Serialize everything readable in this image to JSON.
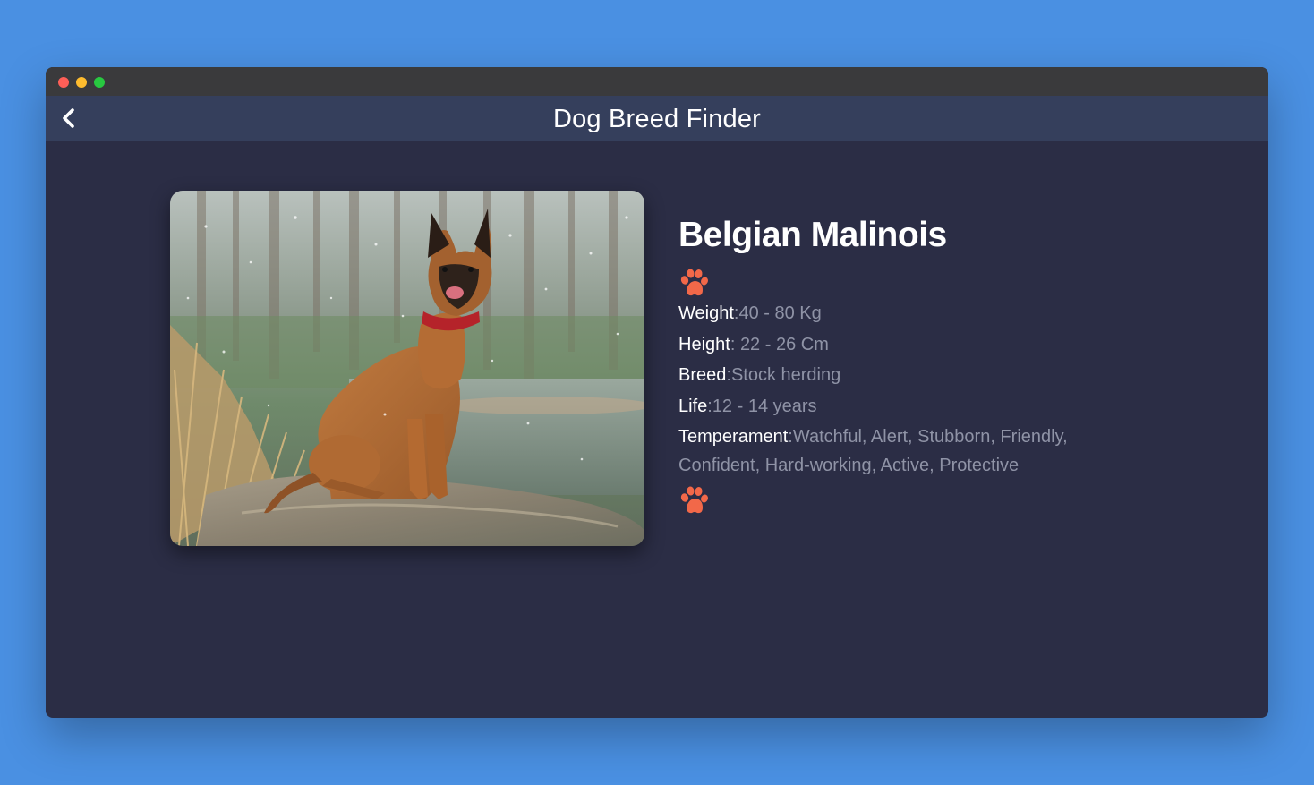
{
  "window": {
    "controls": [
      "close",
      "minimize",
      "maximize"
    ]
  },
  "appbar": {
    "title": "Dog Breed Finder",
    "back_icon": "chevron-left-icon"
  },
  "breed": {
    "name": "Belgian Malinois",
    "photo_description": "dog-photo",
    "divider_icon": "paw-icon",
    "attributes": [
      {
        "label": "Weight",
        "sep": ":",
        "value": "40 - 80 Kg"
      },
      {
        "label": "Height",
        "sep": ": ",
        "value": "22 - 26 Cm"
      },
      {
        "label": "Breed",
        "sep": ":",
        "value": "Stock herding"
      },
      {
        "label": "Life",
        "sep": ":",
        "value": "12 - 14 years"
      },
      {
        "label": "Temperament",
        "sep": ":",
        "value": "Watchful, Alert, Stubborn, Friendly, Confident, Hard-working, Active, Protective"
      }
    ]
  },
  "colors": {
    "background": "#4a90e2",
    "window": "#2b2d45",
    "appbar": "#353f5c",
    "titlebar": "#3a3a3c",
    "accent": "#f26849",
    "muted_text": "#8f93a6"
  }
}
